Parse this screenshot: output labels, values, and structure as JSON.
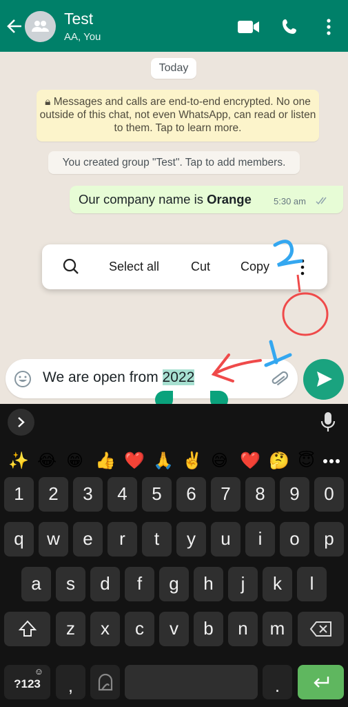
{
  "header": {
    "title": "Test",
    "subtitle": "AA, You",
    "icons": [
      "back-arrow-icon",
      "group-avatar-icon",
      "video-call-icon",
      "voice-call-icon",
      "more-options-icon"
    ],
    "color": "#008069"
  },
  "chat": {
    "date_chip": "Today",
    "encryption_notice": "Messages and calls are end-to-end encrypted. No one outside of this chat, not even WhatsApp, can read or listen to them. Tap to learn more.",
    "system_message": "You created group \"Test\". Tap to add members.",
    "messages": [
      {
        "text_prefix": "Our company name is ",
        "text_bold": "Orange",
        "time": "5:30 am",
        "status": "read"
      }
    ]
  },
  "selection_toolbar": {
    "items": [
      {
        "label": "",
        "icon": "search-icon"
      },
      {
        "label": "Select all"
      },
      {
        "label": "Cut"
      },
      {
        "label": "Copy"
      },
      {
        "label": "",
        "icon": "more-vert-icon"
      }
    ]
  },
  "composer": {
    "value_prefix": "We are open from ",
    "value_selected": "2022",
    "accent": "#1aa37f"
  },
  "annotations": {
    "label_1": "1",
    "label_2": "2"
  },
  "keyboard": {
    "emoji_suggestions": [
      "✨",
      "😂",
      "😁",
      "👍",
      "❤️",
      "🙏",
      "✌️",
      "😅",
      "❤️",
      "🤔",
      "😇"
    ],
    "row_numbers": [
      "1",
      "2",
      "3",
      "4",
      "5",
      "6",
      "7",
      "8",
      "9",
      "0"
    ],
    "row1": [
      "q",
      "w",
      "e",
      "r",
      "t",
      "y",
      "u",
      "i",
      "o",
      "p"
    ],
    "row2": [
      "a",
      "s",
      "d",
      "f",
      "g",
      "h",
      "j",
      "k",
      "l"
    ],
    "row3": [
      "z",
      "x",
      "c",
      "v",
      "b",
      "n",
      "m"
    ],
    "symbols_key": "?123",
    "comma_key": ",",
    "period_key": ".",
    "enter_color": "#5fb75f"
  }
}
